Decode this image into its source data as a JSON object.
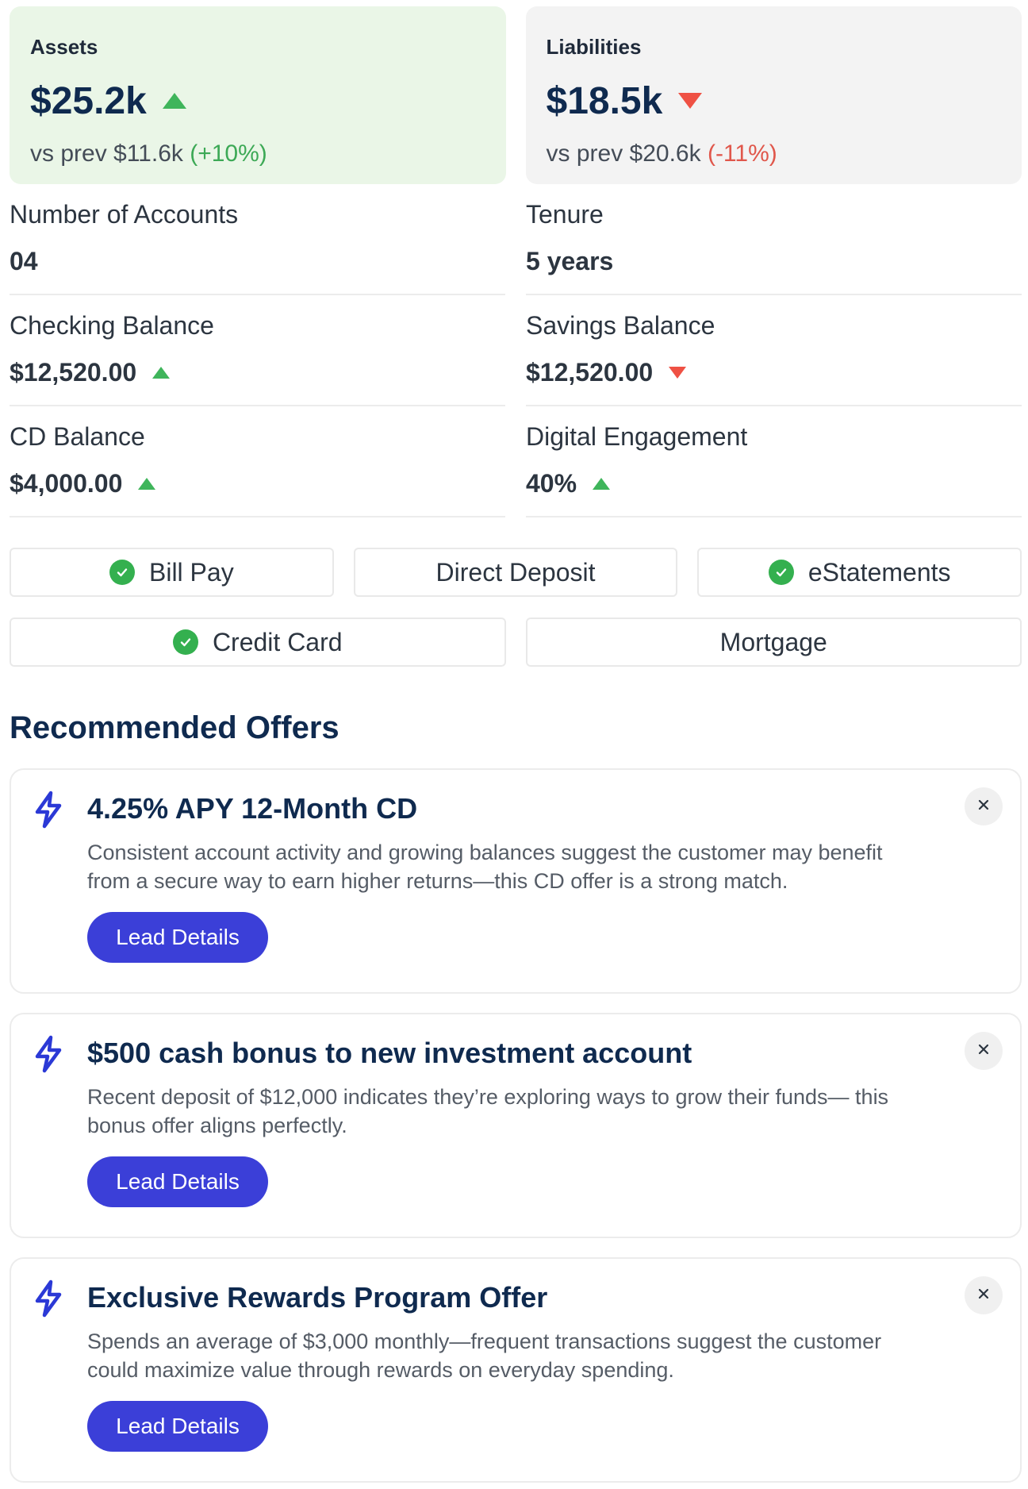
{
  "kpis": {
    "assets": {
      "label": "Assets",
      "value": "$25.2k",
      "trend": "up",
      "prev_text": "vs prev $11.6k",
      "change": "(+10%)"
    },
    "liabilities": {
      "label": "Liabilities",
      "value": "$18.5k",
      "trend": "down",
      "prev_text": "vs prev $20.6k",
      "change": "(-11%)"
    }
  },
  "metrics": [
    {
      "label": "Number of Accounts",
      "value": "04",
      "trend": ""
    },
    {
      "label": "Tenure",
      "value": "5 years",
      "trend": ""
    },
    {
      "label": "Checking Balance",
      "value": "$12,520.00",
      "trend": "up"
    },
    {
      "label": "Savings Balance",
      "value": "$12,520.00",
      "trend": "down"
    },
    {
      "label": "CD Balance",
      "value": "$4,000.00",
      "trend": "up"
    },
    {
      "label": "Digital Engagement",
      "value": "40%",
      "trend": "up"
    }
  ],
  "products": [
    {
      "label": "Bill Pay",
      "checked": true
    },
    {
      "label": "Direct Deposit",
      "checked": false
    },
    {
      "label": "eStatements",
      "checked": true
    },
    {
      "label": "Credit Card",
      "checked": true
    },
    {
      "label": "Mortgage",
      "checked": false
    }
  ],
  "offers_section": {
    "title": "Recommended Offers"
  },
  "offers": [
    {
      "title": "4.25% APY 12-Month CD",
      "description": "Consistent account activity and growing balances suggest the customer may benefit from a secure way to earn higher returns—this CD offer is a strong match.",
      "button": "Lead Details"
    },
    {
      "title": "$500 cash bonus to new investment account",
      "description": "Recent deposit of $12,000 indicates they’re exploring ways to grow their funds— this bonus offer aligns perfectly.",
      "button": "Lead Details"
    },
    {
      "title": "Exclusive Rewards Program Offer",
      "description": "Spends an average of $3,000 monthly—frequent transactions suggest the customer could maximize value through rewards on everyday spending.",
      "button": "Lead Details"
    }
  ],
  "icons": {
    "up": "triangle-up-icon",
    "down": "triangle-down-icon",
    "check": "check-circle-icon",
    "bolt": "lightning-bolt-icon",
    "close": "close-icon"
  },
  "colors": {
    "positive": "#3fb55b",
    "negative": "#ef5144",
    "accent": "#3b3fd8",
    "heading": "#0f2a4f"
  }
}
